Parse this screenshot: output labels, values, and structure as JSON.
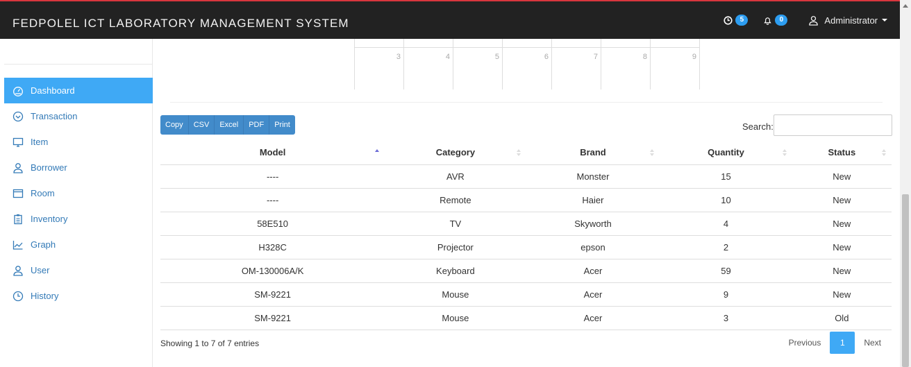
{
  "header": {
    "brand": "FEDPOLEL ICT LABORATORY MANAGEMENT SYSTEM",
    "clock_count": "5",
    "bell_count": "0",
    "user": "Administrator"
  },
  "sidebar": {
    "items": [
      {
        "label": "Dashboard",
        "icon": "dashboard-icon",
        "active": true
      },
      {
        "label": "Transaction",
        "icon": "chevron-circle-icon"
      },
      {
        "label": "Item",
        "icon": "monitor-icon"
      },
      {
        "label": "Borrower",
        "icon": "user-icon"
      },
      {
        "label": "Room",
        "icon": "window-icon"
      },
      {
        "label": "Inventory",
        "icon": "clipboard-icon"
      },
      {
        "label": "Graph",
        "icon": "line-chart-icon"
      },
      {
        "label": "User",
        "icon": "user-icon"
      },
      {
        "label": "History",
        "icon": "clock-icon"
      }
    ]
  },
  "calendar": {
    "days": [
      "3",
      "4",
      "5",
      "6",
      "7",
      "8",
      "9"
    ]
  },
  "toolbar": {
    "buttons": [
      "Copy",
      "CSV",
      "Excel",
      "PDF",
      "Print"
    ]
  },
  "search": {
    "label": "Search:",
    "value": ""
  },
  "table": {
    "columns": [
      "Model",
      "Category",
      "Brand",
      "Quantity",
      "Status"
    ],
    "rows": [
      [
        "----",
        "AVR",
        "Monster",
        "15",
        "New"
      ],
      [
        "----",
        "Remote",
        "Haier",
        "10",
        "New"
      ],
      [
        "58E510",
        "TV",
        "Skyworth",
        "4",
        "New"
      ],
      [
        "H328C",
        "Projector",
        "epson",
        "2",
        "New"
      ],
      [
        "OM-130006A/K",
        "Keyboard",
        "Acer",
        "59",
        "New"
      ],
      [
        "SM-9221",
        "Mouse",
        "Acer",
        "9",
        "New"
      ],
      [
        "SM-9221",
        "Mouse",
        "Acer",
        "3",
        "Old"
      ]
    ]
  },
  "footer": {
    "info": "Showing 1 to 7 of 7 entries",
    "previous": "Previous",
    "page": "1",
    "next": "Next"
  }
}
